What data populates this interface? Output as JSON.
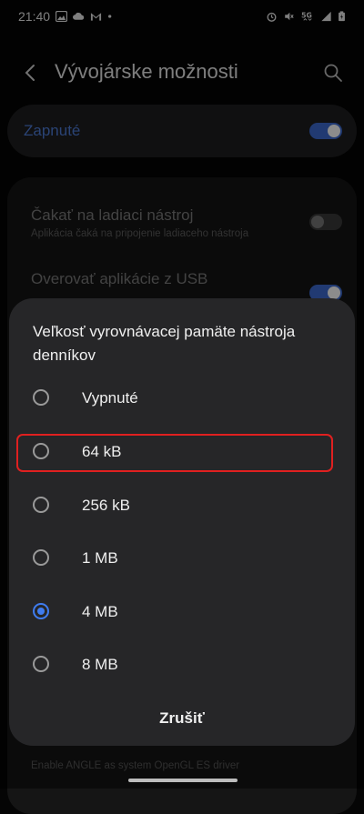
{
  "status_bar": {
    "time": "21:40",
    "left_icons": [
      "gallery-icon",
      "cloud-icon",
      "gmail-icon",
      "dot-icon"
    ],
    "right_icons": [
      "alarm-icon",
      "mute-icon",
      "5g-icon",
      "signal-icon",
      "battery-icon"
    ]
  },
  "header": {
    "title": "Vývojárske možnosti"
  },
  "master_switch": {
    "label": "Zapnuté",
    "state": "on"
  },
  "settings": [
    {
      "title": "Čakať na ladiaci nástroj",
      "subtitle": "Aplikácia čaká na pripojenie ladiaceho nástroja",
      "toggle": "off"
    },
    {
      "title": "Overovať aplikácie z USB",
      "subtitle": "",
      "toggle": "on"
    }
  ],
  "dialog": {
    "title": "Veľkosť vyrovnávacej pamäte nástroja denníkov",
    "options": [
      {
        "label": "Vypnuté",
        "selected": false
      },
      {
        "label": "64 kB",
        "selected": false,
        "highlighted": true
      },
      {
        "label": "256 kB",
        "selected": false
      },
      {
        "label": "1 MB",
        "selected": false
      },
      {
        "label": "4 MB",
        "selected": true
      },
      {
        "label": "8 MB",
        "selected": false
      }
    ],
    "cancel_label": "Zrušiť"
  },
  "background_footer_text": "Enable ANGLE as system OpenGL ES driver",
  "colors": {
    "accent": "#3f7cf0",
    "highlight_border": "#e02020",
    "dialog_bg": "#262628"
  }
}
